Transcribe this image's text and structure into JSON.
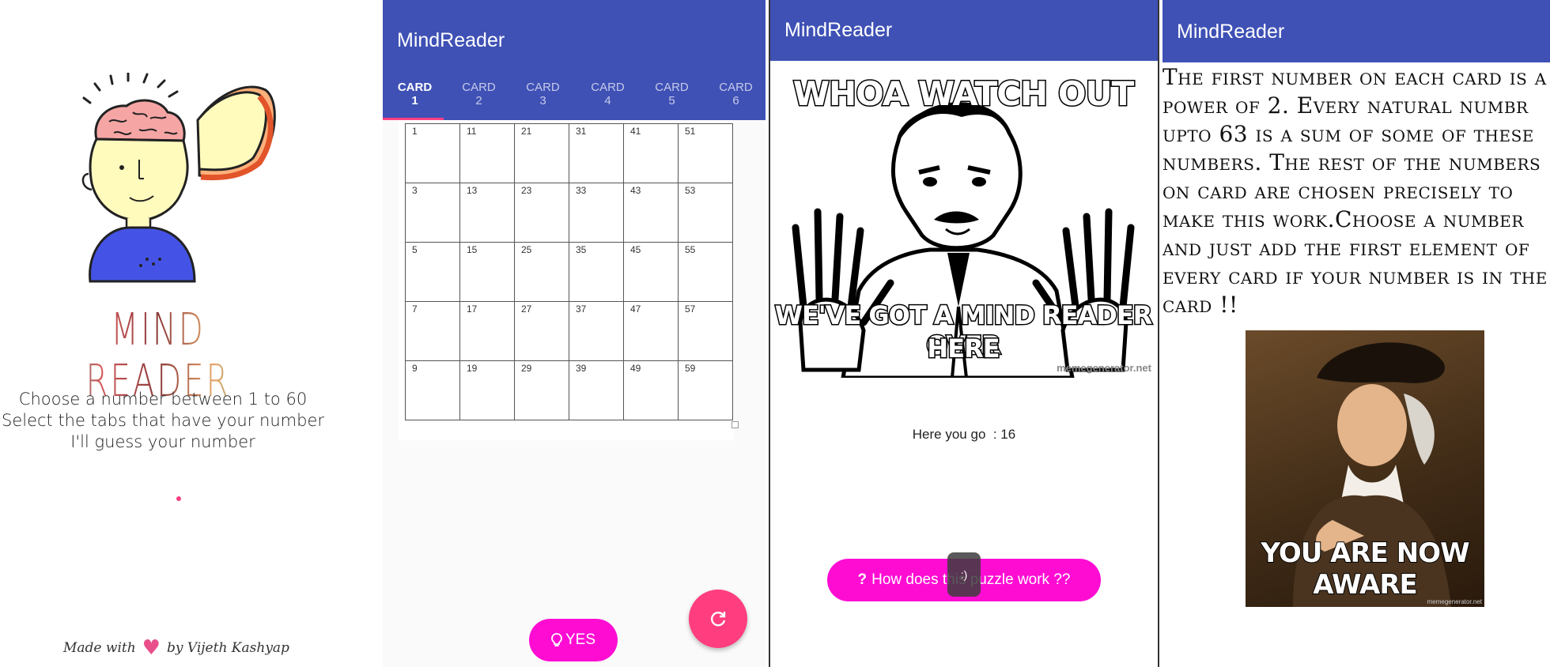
{
  "colors": {
    "primary": "#3f51b5",
    "accent": "#ff4081",
    "yes_button": "#ff0cd3",
    "fab": "#ff3d7f"
  },
  "splash": {
    "app_name": "MIND READER",
    "instructions": [
      "Choose a number between 1 to 60",
      "Select the tabs that have your number",
      "I'll guess your number"
    ],
    "footer": {
      "prefix": "Made with",
      "suffix": "by Vijeth Kashyap"
    }
  },
  "cards_screen": {
    "app_title": "MindReader",
    "tabs": [
      {
        "label": "CARD",
        "number": "1"
      },
      {
        "label": "CARD",
        "number": "2"
      },
      {
        "label": "CARD",
        "number": "3"
      },
      {
        "label": "CARD",
        "number": "4"
      },
      {
        "label": "CARD",
        "number": "5"
      },
      {
        "label": "CARD",
        "number": "6"
      }
    ],
    "grid_rows": [
      [
        "1",
        "11",
        "21",
        "31",
        "41",
        "51"
      ],
      [
        "3",
        "13",
        "23",
        "33",
        "43",
        "53"
      ],
      [
        "5",
        "15",
        "25",
        "35",
        "45",
        "55"
      ],
      [
        "7",
        "17",
        "27",
        "37",
        "47",
        "57"
      ],
      [
        "9",
        "19",
        "29",
        "39",
        "49",
        "59"
      ]
    ],
    "yes_label": "YES",
    "yes_icon": "lightbulb-icon",
    "fab_icon": "refresh-icon"
  },
  "result_screen": {
    "app_title": "MindReader",
    "meme_top": "WHOA WATCH OUT",
    "meme_bottom_line1": "WE'VE GOT A MIND READER OVER",
    "meme_bottom_line2": "HERE",
    "meme_watermark": "memegenerator.net",
    "result_label": "Here you go  : 16",
    "help_label": "How does this puzzle work ??",
    "help_icon": "question-icon",
    "toast_text": ":)"
  },
  "explanation_screen": {
    "app_title": "MindReader",
    "explanation": "The first number on each card is a power of 2. Every natural numbr upto 63 is a sum of some of these numbers. The rest of the numbers on card are chosen precisely to make this work.Choose a number and just add the first element of every card if your number is in the card !!",
    "meme_caption_line1": "YOU ARE NOW",
    "meme_caption_line2": "AWARE",
    "meme_watermark": "memegenerator.net"
  }
}
